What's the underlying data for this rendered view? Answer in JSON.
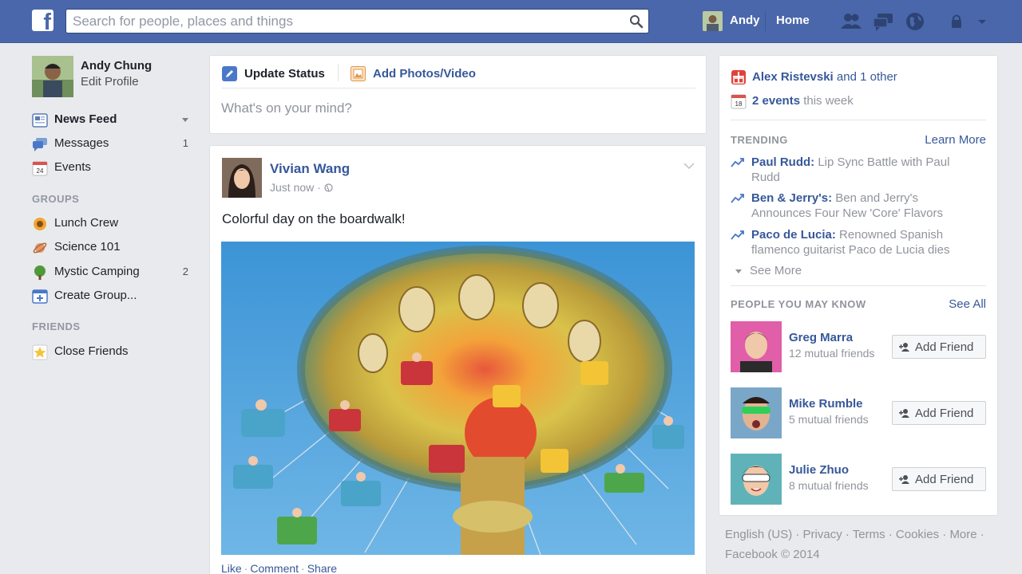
{
  "topbar": {
    "logo": "f",
    "search_placeholder": "Search for people, places and things",
    "user_name": "Andy",
    "home_label": "Home",
    "icons": [
      "friend-requests-icon",
      "messages-icon",
      "notifications-globe-icon",
      "privacy-lock-icon"
    ]
  },
  "left_nav": {
    "profile": {
      "name": "Andy Chung",
      "edit_label": "Edit Profile"
    },
    "main_items": [
      {
        "label": "News Feed",
        "icon": "news-feed-icon",
        "count": ""
      },
      {
        "label": "Messages",
        "icon": "messages-icon",
        "count": "1"
      },
      {
        "label": "Events",
        "icon": "calendar-icon",
        "count": "",
        "calendar_day": "24"
      }
    ],
    "groups_header": "GROUPS",
    "groups": [
      {
        "label": "Lunch Crew",
        "icon": "sunflower-icon",
        "count": ""
      },
      {
        "label": "Science 101",
        "icon": "planet-icon",
        "count": ""
      },
      {
        "label": "Mystic Camping",
        "icon": "tree-icon",
        "count": "2"
      },
      {
        "label": "Create Group...",
        "icon": "create-group-icon",
        "count": ""
      }
    ],
    "friends_header": "FRIENDS",
    "friends": [
      {
        "label": "Close Friends",
        "icon": "star-icon"
      }
    ]
  },
  "composer": {
    "tab_status": "Update Status",
    "tab_photo": "Add Photos/Video",
    "placeholder": "What's on your mind?"
  },
  "post": {
    "author": "Vivian Wang",
    "time": "Just now",
    "privacy_icon": "public-globe-icon",
    "text": "Colorful day on the boardwalk!",
    "photo_subject": "swing-carousel-photo",
    "actions": {
      "like": "Like",
      "comment": "Comment",
      "share": "Share"
    }
  },
  "right_col": {
    "birthday": {
      "name": "Alex Ristevski",
      "rest": "and 1 other"
    },
    "events": {
      "count_label": "2 events",
      "rest": "this week",
      "calendar_day": "18"
    },
    "trending_header": "TRENDING",
    "learn_more": "Learn More",
    "trending": [
      {
        "topic": "Paul Rudd:",
        "desc": "Lip Sync Battle with Paul Rudd"
      },
      {
        "topic": "Ben & Jerry's:",
        "desc": "Ben and Jerry's Announces Four New 'Core' Flavors"
      },
      {
        "topic": "Paco de Lucia:",
        "desc": "Renowned Spanish flamenco guitarist Paco de Lucia dies"
      }
    ],
    "see_more": "See More",
    "pymk_header": "PEOPLE YOU MAY KNOW",
    "see_all": "See All",
    "people": [
      {
        "name": "Greg Marra",
        "mutual": "12 mutual friends",
        "button": "Add Friend"
      },
      {
        "name": "Mike Rumble",
        "mutual": "5 mutual friends",
        "button": "Add Friend"
      },
      {
        "name": "Julie Zhuo",
        "mutual": "8 mutual friends",
        "button": "Add Friend"
      }
    ]
  },
  "footer": {
    "line1": "English (US) · Privacy · Terms · Cookies · More ·",
    "line2": "Facebook © 2014"
  },
  "colors": {
    "brand_blue": "#4a67ab",
    "link_blue": "#365899",
    "page_bg": "#e9eaed",
    "muted_text": "#90949c"
  }
}
